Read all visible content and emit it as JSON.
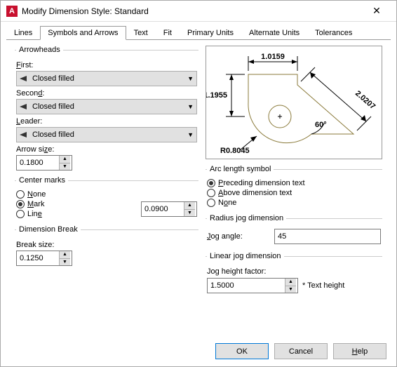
{
  "window": {
    "title": "Modify Dimension Style: Standard"
  },
  "tabs": [
    "Lines",
    "Symbols and Arrows",
    "Text",
    "Fit",
    "Primary Units",
    "Alternate Units",
    "Tolerances"
  ],
  "active_tab": 1,
  "arrowheads": {
    "legend": "Arrowheads",
    "first_label": "First:",
    "first_value": "Closed filled",
    "second_label": "Second:",
    "second_value": "Closed filled",
    "leader_label": "Leader:",
    "leader_value": "Closed filled",
    "size_label": "Arrow size:",
    "size_value": "0.1800"
  },
  "center_marks": {
    "legend": "Center marks",
    "options": [
      "None",
      "Mark",
      "Line"
    ],
    "selected": "Mark",
    "value": "0.0900"
  },
  "dim_break": {
    "legend": "Dimension Break",
    "label": "Break size:",
    "value": "0.1250"
  },
  "arc_length": {
    "legend": "Arc length symbol",
    "options": [
      "Preceding dimension text",
      "Above dimension text",
      "None"
    ],
    "selected": "Preceding dimension text"
  },
  "radius_jog": {
    "legend": "Radius jog dimension",
    "label": "Jog angle:",
    "value": "45"
  },
  "linear_jog": {
    "legend": "Linear jog dimension",
    "label": "Jog height factor:",
    "value": "1.5000",
    "suffix": "* Text height"
  },
  "preview_labels": {
    "top": "1.0159",
    "left": "1.1955",
    "diag": "2.0207",
    "angle": "60°",
    "radius": "R0.8045"
  },
  "buttons": {
    "ok": "OK",
    "cancel": "Cancel",
    "help": "Help"
  }
}
